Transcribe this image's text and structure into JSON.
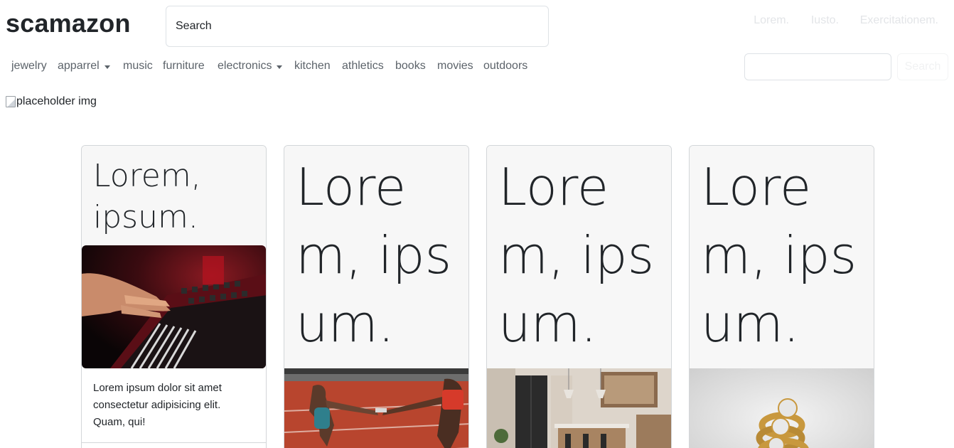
{
  "brand": "scamazon",
  "search": {
    "value": "Search"
  },
  "top_links": [
    "Lorem.",
    "Iusto.",
    "Exercitationem."
  ],
  "nav": {
    "items": [
      {
        "label": "jewelry",
        "dropdown": false
      },
      {
        "label": "apparrel",
        "dropdown": true
      },
      {
        "label": "music",
        "dropdown": false
      },
      {
        "label": "furniture",
        "dropdown": false
      },
      {
        "label": "electronics",
        "dropdown": true
      },
      {
        "label": "kitchen",
        "dropdown": false
      },
      {
        "label": "athletics",
        "dropdown": false
      },
      {
        "label": "books",
        "dropdown": false
      },
      {
        "label": "movies",
        "dropdown": false
      },
      {
        "label": "outdoors",
        "dropdown": false
      }
    ],
    "search_value": "",
    "search_button": "Search"
  },
  "placeholder_alt": "placeholder img",
  "cards": [
    {
      "title": "Lorem, ipsum.",
      "text": "Lorem ipsum dolor sit amet consectetur adipisicing elit. Quam, qui!",
      "image": "keyboard-hands-photo"
    },
    {
      "title": "Lorem, ipsum.",
      "image": "relay-race-photo"
    },
    {
      "title": "Lorem, ipsum.",
      "image": "kitchen-photo"
    },
    {
      "title": "Lorem, ipsum.",
      "image": "gold-rings-photo"
    }
  ],
  "colors": {
    "text": "#212529",
    "nav_text": "#5c636a",
    "card_header_bg": "#f7f7f7",
    "card_border": "#d3d6d9",
    "faded_links": "#e3e5e8"
  }
}
